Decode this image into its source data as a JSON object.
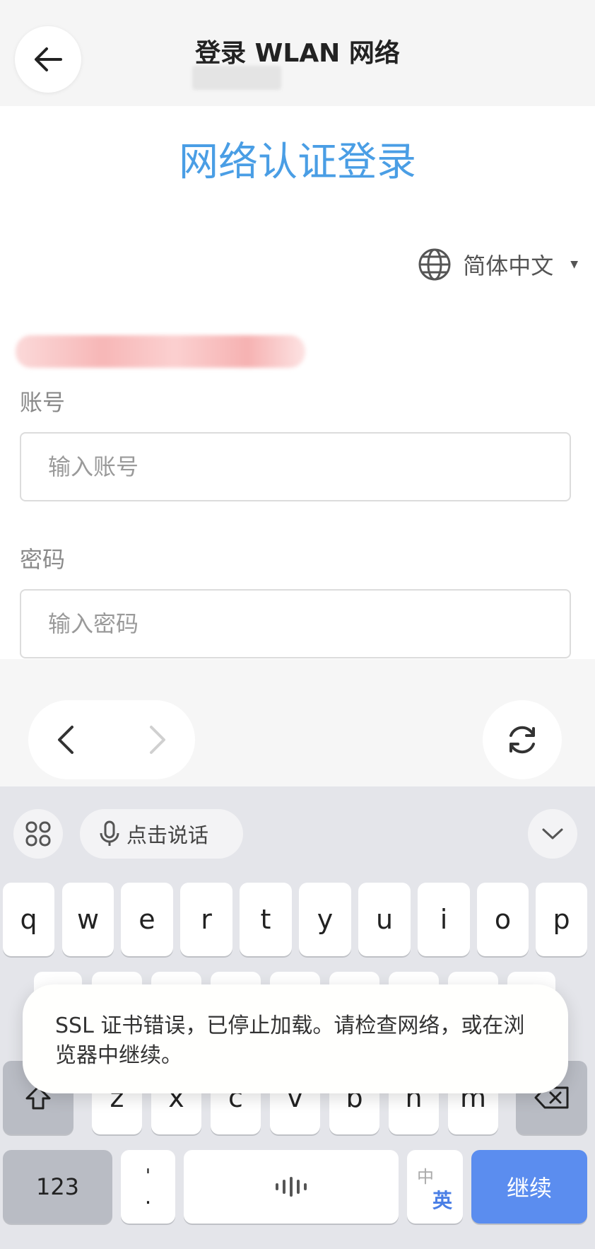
{
  "header": {
    "title": "登录 WLAN 网络"
  },
  "page": {
    "heading": "网络认证登录",
    "language": "简体中文",
    "account_label": "账号",
    "account_placeholder": "输入账号",
    "password_label": "密码",
    "password_placeholder": "输入密码"
  },
  "toolbar": {
    "voice_input_label": "点击说话"
  },
  "keyboard": {
    "row1": [
      "q",
      "w",
      "e",
      "r",
      "t",
      "y",
      "u",
      "i",
      "o",
      "p"
    ],
    "row3": [
      "z",
      "x",
      "c",
      "v",
      "b",
      "n",
      "m"
    ],
    "numbers_key": "123",
    "punct_top": "'",
    "punct_bottom": ".",
    "lang_switch_top": "中",
    "lang_switch_bottom": "英",
    "continue_key": "继续"
  },
  "toast": {
    "message": "SSL 证书错误，已停止加载。请检查网络，或在浏览器中继续。"
  },
  "colors": {
    "heading_blue": "#4a9ee5",
    "action_blue": "#5b8def"
  }
}
